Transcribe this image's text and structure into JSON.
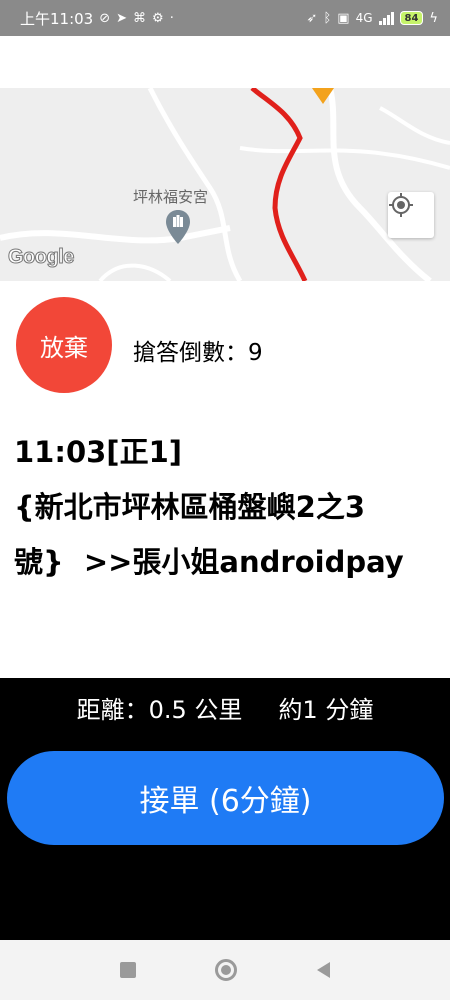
{
  "status_bar": {
    "time": "上午11:03",
    "network": "4G",
    "battery": "84",
    "icons": [
      "sync-off-icon",
      "telegram-icon",
      "tower-icon",
      "gear-icon",
      "dot-icon",
      "location-icon",
      "bluetooth-icon",
      "hd-icon",
      "signal-icon",
      "battery-icon",
      "charging-icon"
    ]
  },
  "map": {
    "place_label": "坪林福安宮",
    "provider": "Google",
    "route_color": "#e0201b"
  },
  "job": {
    "abandon_label": "放棄",
    "countdown_label": "搶答倒數：9",
    "order_line1": "11:03[正1]",
    "order_line2": "{新北市坪林區桶盤嶼2之3",
    "order_line3": "號}  >>張小姐androidpay"
  },
  "accept_panel": {
    "distance": "距離：0.5 公里",
    "eta": "約1 分鐘",
    "accept_label": "接單 (6分鐘)"
  },
  "colors": {
    "abandon": "#f24738",
    "accept": "#1f7bf5",
    "panel": "#000000"
  }
}
